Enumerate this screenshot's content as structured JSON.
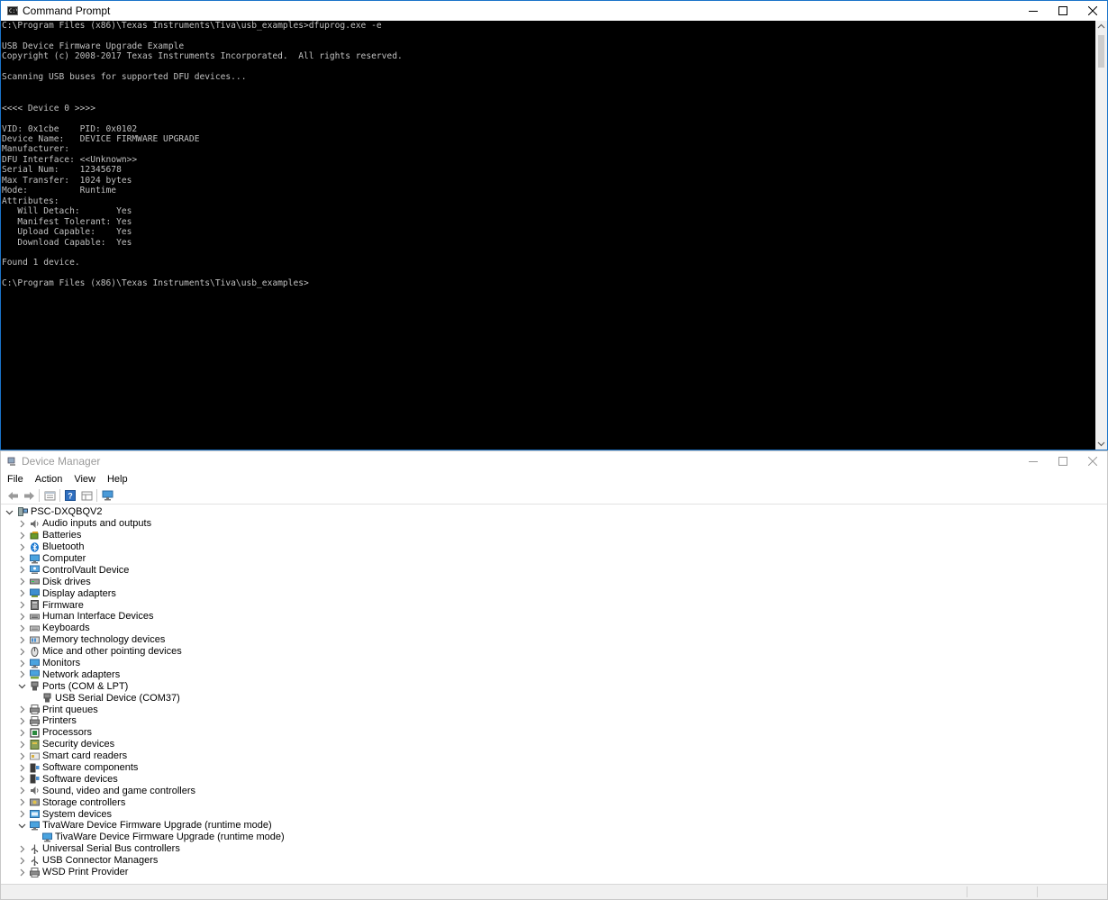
{
  "cmd": {
    "title": "Command Prompt",
    "app_icon_text": "C:\\",
    "lines": [
      "C:\\Program Files (x86)\\Texas Instruments\\Tiva\\usb_examples>dfuprog.exe -e",
      "",
      "USB Device Firmware Upgrade Example",
      "Copyright (c) 2008-2017 Texas Instruments Incorporated.  All rights reserved.",
      "",
      "Scanning USB buses for supported DFU devices...",
      "",
      "",
      "<<<< Device 0 >>>>",
      "",
      "VID: 0x1cbe    PID: 0x0102",
      "Device Name:   DEVICE FIRMWARE UPGRADE",
      "Manufacturer:",
      "DFU Interface: <<Unknown>>",
      "Serial Num:    12345678",
      "Max Transfer:  1024 bytes",
      "Mode:          Runtime",
      "Attributes:",
      "   Will Detach:       Yes",
      "   Manifest Tolerant: Yes",
      "   Upload Capable:    Yes",
      "   Download Capable:  Yes",
      "",
      "Found 1 device.",
      "",
      "C:\\Program Files (x86)\\Texas Instruments\\Tiva\\usb_examples>"
    ],
    "text_color": "#c0c0c0",
    "background": "#000000"
  },
  "dm": {
    "title": "Device Manager",
    "menu": [
      "File",
      "Action",
      "View",
      "Help"
    ],
    "toolbar": [
      "back-icon",
      "forward-icon",
      "properties-icon",
      "help-icon",
      "view-icon",
      "monitor-icon"
    ],
    "root": "PSC-DXQBQV2",
    "nodes": [
      {
        "label": "Audio inputs and outputs",
        "icon": "speaker-icon",
        "level": 1,
        "exp": "collapsed"
      },
      {
        "label": "Batteries",
        "icon": "battery-icon",
        "level": 1,
        "exp": "collapsed"
      },
      {
        "label": "Bluetooth",
        "icon": "bluetooth-icon",
        "level": 1,
        "exp": "collapsed"
      },
      {
        "label": "Computer",
        "icon": "computer-icon",
        "level": 1,
        "exp": "collapsed"
      },
      {
        "label": "ControlVault Device",
        "icon": "controlvault-icon",
        "level": 1,
        "exp": "collapsed"
      },
      {
        "label": "Disk drives",
        "icon": "disk-icon",
        "level": 1,
        "exp": "collapsed"
      },
      {
        "label": "Display adapters",
        "icon": "display-icon",
        "level": 1,
        "exp": "collapsed"
      },
      {
        "label": "Firmware",
        "icon": "firmware-icon",
        "level": 1,
        "exp": "collapsed"
      },
      {
        "label": "Human Interface Devices",
        "icon": "hid-icon",
        "level": 1,
        "exp": "collapsed"
      },
      {
        "label": "Keyboards",
        "icon": "keyboard-icon",
        "level": 1,
        "exp": "collapsed"
      },
      {
        "label": "Memory technology devices",
        "icon": "memory-icon",
        "level": 1,
        "exp": "collapsed"
      },
      {
        "label": "Mice and other pointing devices",
        "icon": "mouse-icon",
        "level": 1,
        "exp": "collapsed"
      },
      {
        "label": "Monitors",
        "icon": "monitor-icon",
        "level": 1,
        "exp": "collapsed"
      },
      {
        "label": "Network adapters",
        "icon": "network-icon",
        "level": 1,
        "exp": "collapsed"
      },
      {
        "label": "Ports (COM & LPT)",
        "icon": "port-icon",
        "level": 1,
        "exp": "expanded"
      },
      {
        "label": "USB Serial Device (COM37)",
        "icon": "port-icon",
        "level": 2,
        "exp": "none"
      },
      {
        "label": "Print queues",
        "icon": "printer-icon",
        "level": 1,
        "exp": "collapsed"
      },
      {
        "label": "Printers",
        "icon": "printer-icon",
        "level": 1,
        "exp": "collapsed"
      },
      {
        "label": "Processors",
        "icon": "processor-icon",
        "level": 1,
        "exp": "collapsed"
      },
      {
        "label": "Security devices",
        "icon": "security-icon",
        "level": 1,
        "exp": "collapsed"
      },
      {
        "label": "Smart card readers",
        "icon": "smartcard-icon",
        "level": 1,
        "exp": "collapsed"
      },
      {
        "label": "Software components",
        "icon": "software-icon",
        "level": 1,
        "exp": "collapsed"
      },
      {
        "label": "Software devices",
        "icon": "software-icon",
        "level": 1,
        "exp": "collapsed"
      },
      {
        "label": "Sound, video and game controllers",
        "icon": "speaker-icon",
        "level": 1,
        "exp": "collapsed"
      },
      {
        "label": "Storage controllers",
        "icon": "storage-icon",
        "level": 1,
        "exp": "collapsed"
      },
      {
        "label": "System devices",
        "icon": "system-icon",
        "level": 1,
        "exp": "collapsed"
      },
      {
        "label": "TivaWare Device Firmware Upgrade (runtime mode)",
        "icon": "monitor-icon",
        "level": 1,
        "exp": "expanded"
      },
      {
        "label": "TivaWare Device Firmware Upgrade (runtime mode)",
        "icon": "monitor-icon",
        "level": 2,
        "exp": "none"
      },
      {
        "label": "Universal Serial Bus controllers",
        "icon": "usb-icon",
        "level": 1,
        "exp": "collapsed"
      },
      {
        "label": "USB Connector Managers",
        "icon": "usb-icon",
        "level": 1,
        "exp": "collapsed"
      },
      {
        "label": "WSD Print Provider",
        "icon": "printer-icon",
        "level": 1,
        "exp": "collapsed"
      }
    ]
  }
}
